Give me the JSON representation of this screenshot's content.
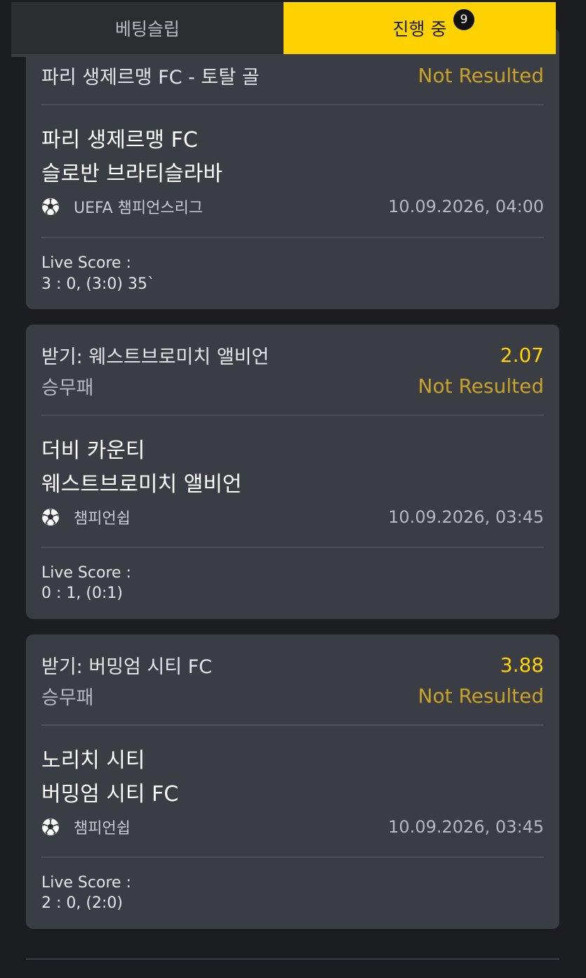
{
  "tabs": {
    "betslip": "베팅슬립",
    "in_progress": "진행 중",
    "badge_count": "9"
  },
  "colors": {
    "accent": "#ffd200",
    "card": "#3a3d43",
    "background": "#1c1d20",
    "status": "#c9a227"
  },
  "bets": [
    {
      "pick": "파리 생제르맹 FC - 토탈 골",
      "status": "Not Resulted",
      "home": "파리 생제르맹 FC",
      "away": "슬로반 브라티슬라바",
      "sport_icon": "soccer-ball-icon",
      "league": "UEFA 챔피언스리그",
      "datetime": "10.09.2026, 04:00",
      "live_label": "Live Score :",
      "live_score": "3 : 0, (3:0) 35`"
    },
    {
      "pick": "받기: 웨스트브로미치 앨비언",
      "odds": "2.07",
      "market": "승무패",
      "status": "Not Resulted",
      "home": "더비 카운티",
      "away": "웨스트브로미치 앨비언",
      "sport_icon": "soccer-ball-icon",
      "league": "챔피언쉽",
      "datetime": "10.09.2026, 03:45",
      "live_label": "Live Score :",
      "live_score": "0 : 1, (0:1)"
    },
    {
      "pick": "받기: 버밍엄 시티 FC",
      "odds": "3.88",
      "market": "승무패",
      "status": "Not Resulted",
      "home": "노리치 시티",
      "away": "버밍엄 시티 FC",
      "sport_icon": "soccer-ball-icon",
      "league": "챔피언쉽",
      "datetime": "10.09.2026, 03:45",
      "live_label": "Live Score :",
      "live_score": "2 : 0, (2:0)"
    }
  ]
}
